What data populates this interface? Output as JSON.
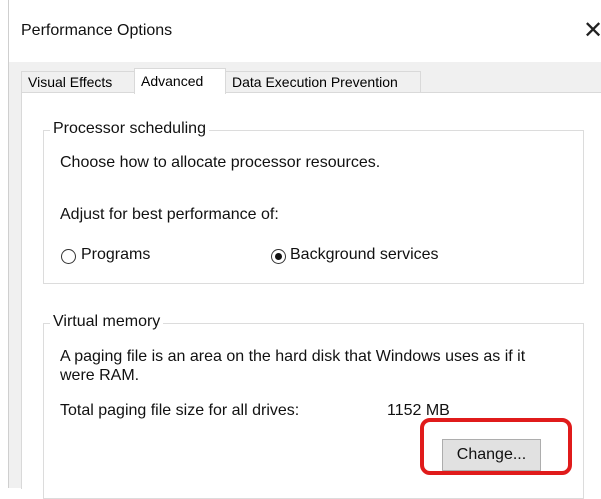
{
  "window": {
    "title": "Performance Options",
    "close_glyph": "✕"
  },
  "tabs": [
    {
      "label": "Visual Effects"
    },
    {
      "label": "Advanced"
    },
    {
      "label": "Data Execution Prevention"
    }
  ],
  "processor": {
    "legend": "Processor scheduling",
    "description": "Choose how to allocate processor resources.",
    "adjust_label": "Adjust for best performance of:",
    "option_programs": "Programs",
    "option_background": "Background services",
    "selected": "Background services"
  },
  "virtual_memory": {
    "legend": "Virtual memory",
    "description_line1": "A paging file is an area on the hard disk that Windows uses as if it",
    "description_line2": "were RAM.",
    "total_label": "Total paging file size for all drives:",
    "total_value": "1152 MB",
    "change_button": "Change..."
  },
  "colors": {
    "highlight": "#e01b1b",
    "accent_blue": "#2b79d0"
  }
}
